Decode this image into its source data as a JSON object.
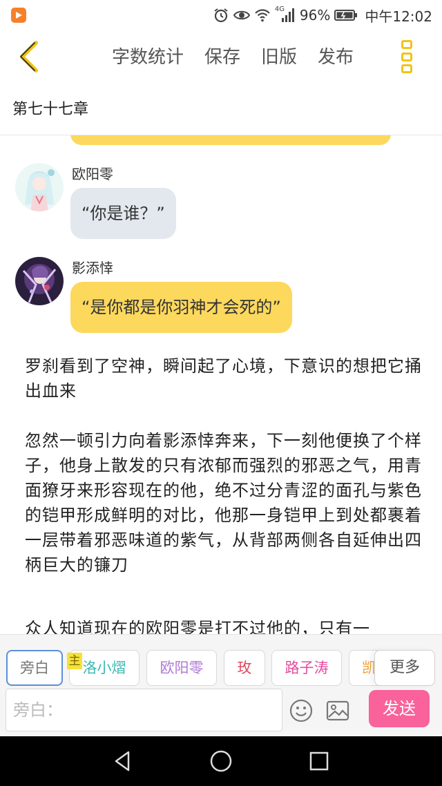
{
  "status_bar": {
    "network": "4G",
    "battery": "96%",
    "time": "中午12:02",
    "icons": [
      "alarm-icon",
      "eye-icon",
      "wifi-icon",
      "signal-icon",
      "battery-icon"
    ]
  },
  "toolbar": {
    "word_count": "字数统计",
    "save": "保存",
    "old_version": "旧版",
    "publish": "发布"
  },
  "chapter": {
    "title": "第七十七章"
  },
  "messages": [
    {
      "name": "欧阳零",
      "text": "“你是谁？”",
      "style": "grey"
    },
    {
      "name": "影添悻",
      "text": "“是你都是你羽神才会死的”",
      "style": "yellow"
    }
  ],
  "narration": [
    "罗刹看到了空神，瞬间起了心境，下意识的想把它捅出血来",
    "忽然一顿引力向着影添悻奔来，下一刻他便换了个样子，他身上散发的只有浓郁而强烈的邪恶之气，用青面獠牙来形容现在的他，绝不过分青涩的面孔与紫色的铠甲形成鲜明的对比，他那一身铠甲上到处都裹着一层带着邪恶味道的紫气，从背部两侧各自延伸出四柄巨大的镰刀",
    "众人知道现在的欧阳零是打不过他的，只有一"
  ],
  "characters": {
    "host_badge": "主",
    "chips": [
      {
        "label": "旁白",
        "color": "#777777"
      },
      {
        "label": "洛小熠",
        "color": "#39b9b0"
      },
      {
        "label": "欧阳零",
        "color": "#b07ad6"
      },
      {
        "label": "玫",
        "color": "#e0475d"
      },
      {
        "label": "路子涛",
        "color": "#e44ba0"
      },
      {
        "label": "凯",
        "color": "#f0a23c"
      }
    ],
    "more": "更多"
  },
  "input": {
    "placeholder": "旁白："
  },
  "send": "发送",
  "colors": {
    "accent": "#f0c419",
    "bubble_yellow": "#fcd85d",
    "send": "#f9629a"
  }
}
